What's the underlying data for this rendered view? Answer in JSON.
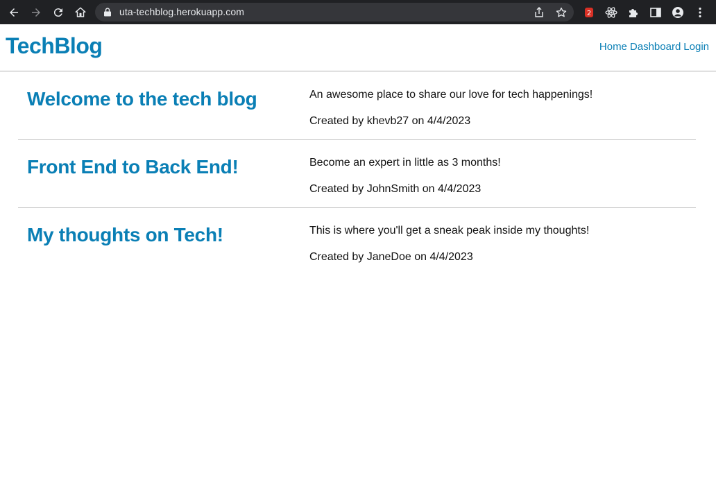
{
  "browser": {
    "url": "uta-techblog.herokuapp.com"
  },
  "site": {
    "brand": "TechBlog",
    "nav": [
      "Home",
      "Dashboard",
      "Login"
    ]
  },
  "posts": [
    {
      "title": "Welcome to the tech blog",
      "description": "An awesome place to share our love for tech happenings!",
      "meta": "Created by khevb27 on 4/4/2023"
    },
    {
      "title": "Front End to Back End!",
      "description": "Become an expert in little as 3 months!",
      "meta": "Created by JohnSmith on 4/4/2023"
    },
    {
      "title": "My thoughts on Tech!",
      "description": "This is where you'll get a sneak peak inside my thoughts!",
      "meta": "Created by JaneDoe on 4/4/2023"
    }
  ],
  "colors": {
    "accent": "#0a7fb5",
    "chrome": "#202124"
  }
}
